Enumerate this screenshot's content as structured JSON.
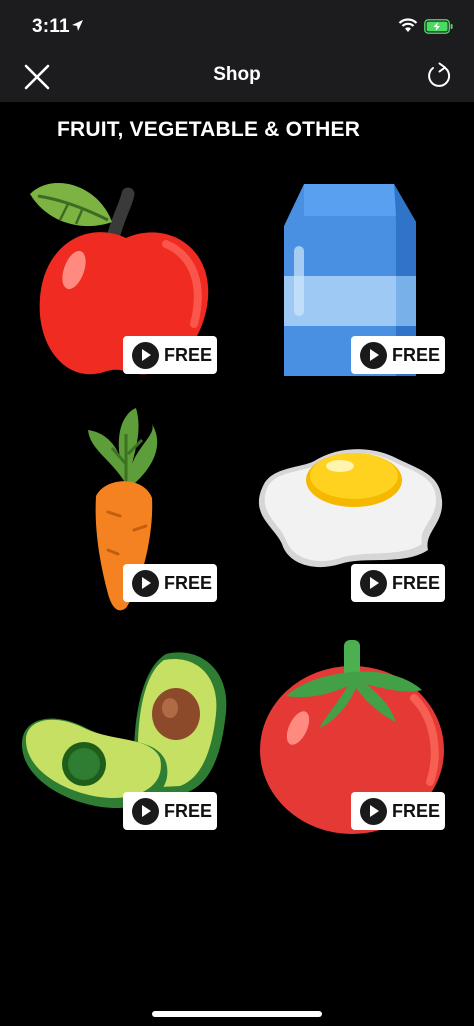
{
  "status_bar": {
    "time": "3:11"
  },
  "nav": {
    "title": "Shop"
  },
  "section": {
    "title": "FRUIT, VEGETABLE & OTHER"
  },
  "items": [
    {
      "name": "apple",
      "badge": "FREE"
    },
    {
      "name": "milk",
      "badge": "FREE"
    },
    {
      "name": "carrot",
      "badge": "FREE"
    },
    {
      "name": "egg",
      "badge": "FREE"
    },
    {
      "name": "avocado",
      "badge": "FREE"
    },
    {
      "name": "tomato",
      "badge": "FREE"
    }
  ],
  "icons": {
    "close": "close-icon",
    "refresh": "refresh-icon",
    "location": "location-arrow-icon",
    "wifi": "wifi-icon",
    "battery": "battery-charging-icon",
    "play": "play-icon"
  },
  "colors": {
    "background": "#000000",
    "bar": "#1c1c1e",
    "badge": "#ffffff",
    "battery": "#4cd964"
  }
}
